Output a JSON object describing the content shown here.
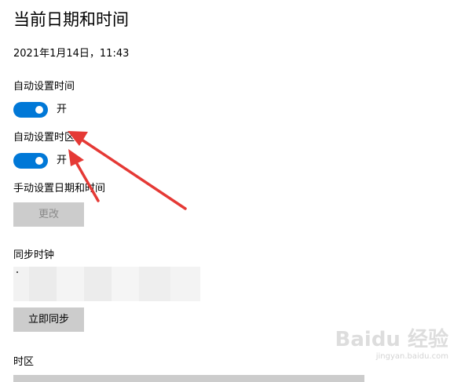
{
  "page": {
    "title": "当前日期和时间",
    "current_datetime": "2021年1月14日，11:43"
  },
  "auto_time": {
    "label": "自动设置时间",
    "state_label": "开",
    "on": true
  },
  "auto_timezone": {
    "label": "自动设置时区",
    "state_label": "开",
    "on": true
  },
  "manual": {
    "label": "手动设置日期和时间",
    "change_button": "更改",
    "change_enabled": false
  },
  "sync": {
    "label": "同步时钟",
    "sync_button": "立即同步"
  },
  "timezone": {
    "label": "时区"
  },
  "watermark": {
    "main": "Baidu 经验",
    "url": "jingyan.baidu.com"
  },
  "colors": {
    "toggle_on": "#0078d7",
    "button_bg": "#cccccc",
    "annotation_arrow": "#e53935"
  }
}
